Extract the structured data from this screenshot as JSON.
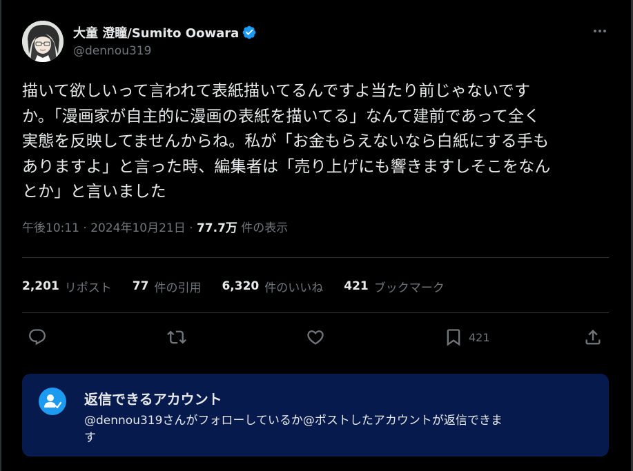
{
  "author": {
    "name": "大童 澄瞳/Sumito Oowara",
    "handle": "@dennou319",
    "verified": true
  },
  "tweet": {
    "lines": [
      "描いて欲しいって言われて表紙描いてるんですよ当たり前じゃないです",
      "か。「漫画家が自主的に漫画の表紙を描いてる」なんて建前であって全く",
      "実態を反映してませんからね。私が「お金もらえないなら白紙にする手も",
      "ありますよ」と言った時、編集者は「売り上げにも響きますしそこをなん",
      "とか」と言いました"
    ]
  },
  "meta": {
    "timestamp": "午後10:11 · 2024年10月21日 · ",
    "views_count": "77.7万",
    "views_label": " 件の表示"
  },
  "stats": {
    "reposts": {
      "count": "2,201",
      "label": "リポスト"
    },
    "quotes": {
      "count": "77",
      "label": "件の引用"
    },
    "likes": {
      "count": "6,320",
      "label": "件のいいね"
    },
    "bookmarks": {
      "count": "421",
      "label": "ブックマーク"
    }
  },
  "actions": {
    "reply_icon": "reply-icon",
    "repost_icon": "repost-icon",
    "like_icon": "heart-icon",
    "bookmark_icon": "bookmark-icon",
    "bookmark_count": "421",
    "share_icon": "share-icon"
  },
  "reply_restriction": {
    "title": "返信できるアカウント",
    "description_lines": [
      "@dennou319さんがフォローしているか@ポストしたアカウントが返信できま",
      "す"
    ]
  },
  "colors": {
    "background": "#000000",
    "text": "#e7e9ea",
    "secondary": "#71767b",
    "accent": "#1d9bf0",
    "divider": "#2f3336",
    "reply_box": "#071a4d"
  }
}
